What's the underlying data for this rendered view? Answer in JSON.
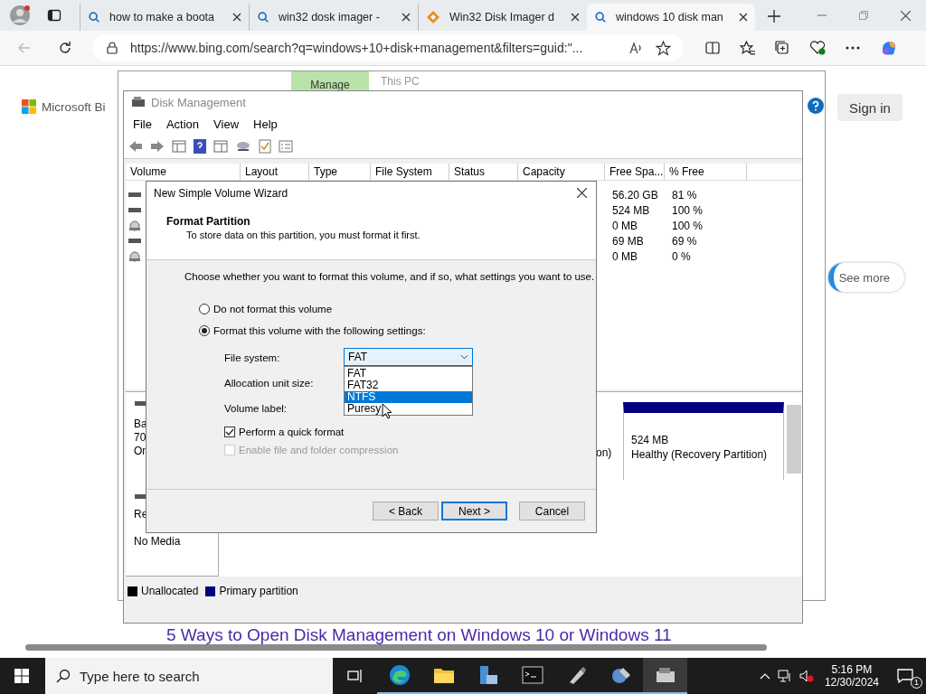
{
  "browser": {
    "tabs": [
      {
        "title": "how to make a boota",
        "selected": false,
        "kind": "search"
      },
      {
        "title": "win32 dosk imager -",
        "selected": false,
        "kind": "search"
      },
      {
        "title": "Win32 Disk Imager d",
        "selected": false,
        "kind": "site"
      },
      {
        "title": "windows 10 disk man",
        "selected": true,
        "kind": "search"
      }
    ],
    "address": "https://www.bing.com/search?q=windows+10+disk+management&filters=guid:\"..."
  },
  "page": {
    "logo": "Microsoft Bi",
    "sign_in": "Sign in",
    "see_more": "See more",
    "headline": "5 Ways to Open Disk Management on Windows 10 or Windows 11"
  },
  "explorer": {
    "ribbon_tab": "Manage",
    "title": "This PC"
  },
  "disk_management": {
    "title": "Disk Management",
    "menu": [
      "File",
      "Action",
      "View",
      "Help"
    ],
    "columns": [
      "Volume",
      "Layout",
      "Type",
      "File System",
      "Status",
      "Capacity",
      "Free Spa...",
      "% Free"
    ],
    "rows": [
      {
        "free_space": "56.20 GB",
        "percent_free": "81 %",
        "kind": "disk"
      },
      {
        "free_space": "524 MB",
        "percent_free": "100 %",
        "kind": "disk"
      },
      {
        "free_space": "0 MB",
        "percent_free": "100 %",
        "kind": "cd"
      },
      {
        "free_space": "69 MB",
        "percent_free": "69 %",
        "kind": "disk"
      },
      {
        "free_space": "0 MB",
        "percent_free": "0 %",
        "kind": "cd"
      }
    ],
    "disk0": {
      "label_lines": [
        "Ba",
        "70",
        "On"
      ],
      "partition_tail": "on)",
      "recovery_size": "524 MB",
      "recovery_status": "Healthy (Recovery Partition)"
    },
    "disk1": {
      "label": "Re",
      "status": "No Media"
    },
    "legend": [
      {
        "label": "Unallocated",
        "color": "#000000"
      },
      {
        "label": "Primary partition",
        "color": "#000080"
      }
    ]
  },
  "wizard": {
    "title": "New Simple Volume Wizard",
    "heading": "Format Partition",
    "subheading": "To store data on this partition, you must format it first.",
    "instruction": "Choose whether you want to format this volume, and if so, what settings you want to use.",
    "options": [
      {
        "label": "Do not format this volume",
        "selected": false
      },
      {
        "label": "Format this volume with the following settings:",
        "selected": true
      }
    ],
    "file_system_label": "File system:",
    "file_system_value": "FAT",
    "allocation_label": "Allocation unit size:",
    "volume_label_label": "Volume label:",
    "dropdown": [
      {
        "label": "FAT",
        "selected": false
      },
      {
        "label": "FAT32",
        "selected": false
      },
      {
        "label": "NTFS",
        "selected": true
      },
      {
        "label": "Puresy",
        "selected": false
      }
    ],
    "checkboxes": [
      {
        "label": "Perform a quick format",
        "checked": true,
        "disabled": false
      },
      {
        "label": "Enable file and folder compression",
        "checked": false,
        "disabled": true
      }
    ],
    "buttons": [
      {
        "label": "< Back",
        "focused": false
      },
      {
        "label": "Next >",
        "focused": true
      },
      {
        "label": "Cancel",
        "focused": false
      }
    ]
  },
  "taskbar": {
    "search_placeholder": "Type here to search",
    "time": "5:16 PM",
    "date": "12/30/2024",
    "notifications": "1"
  }
}
